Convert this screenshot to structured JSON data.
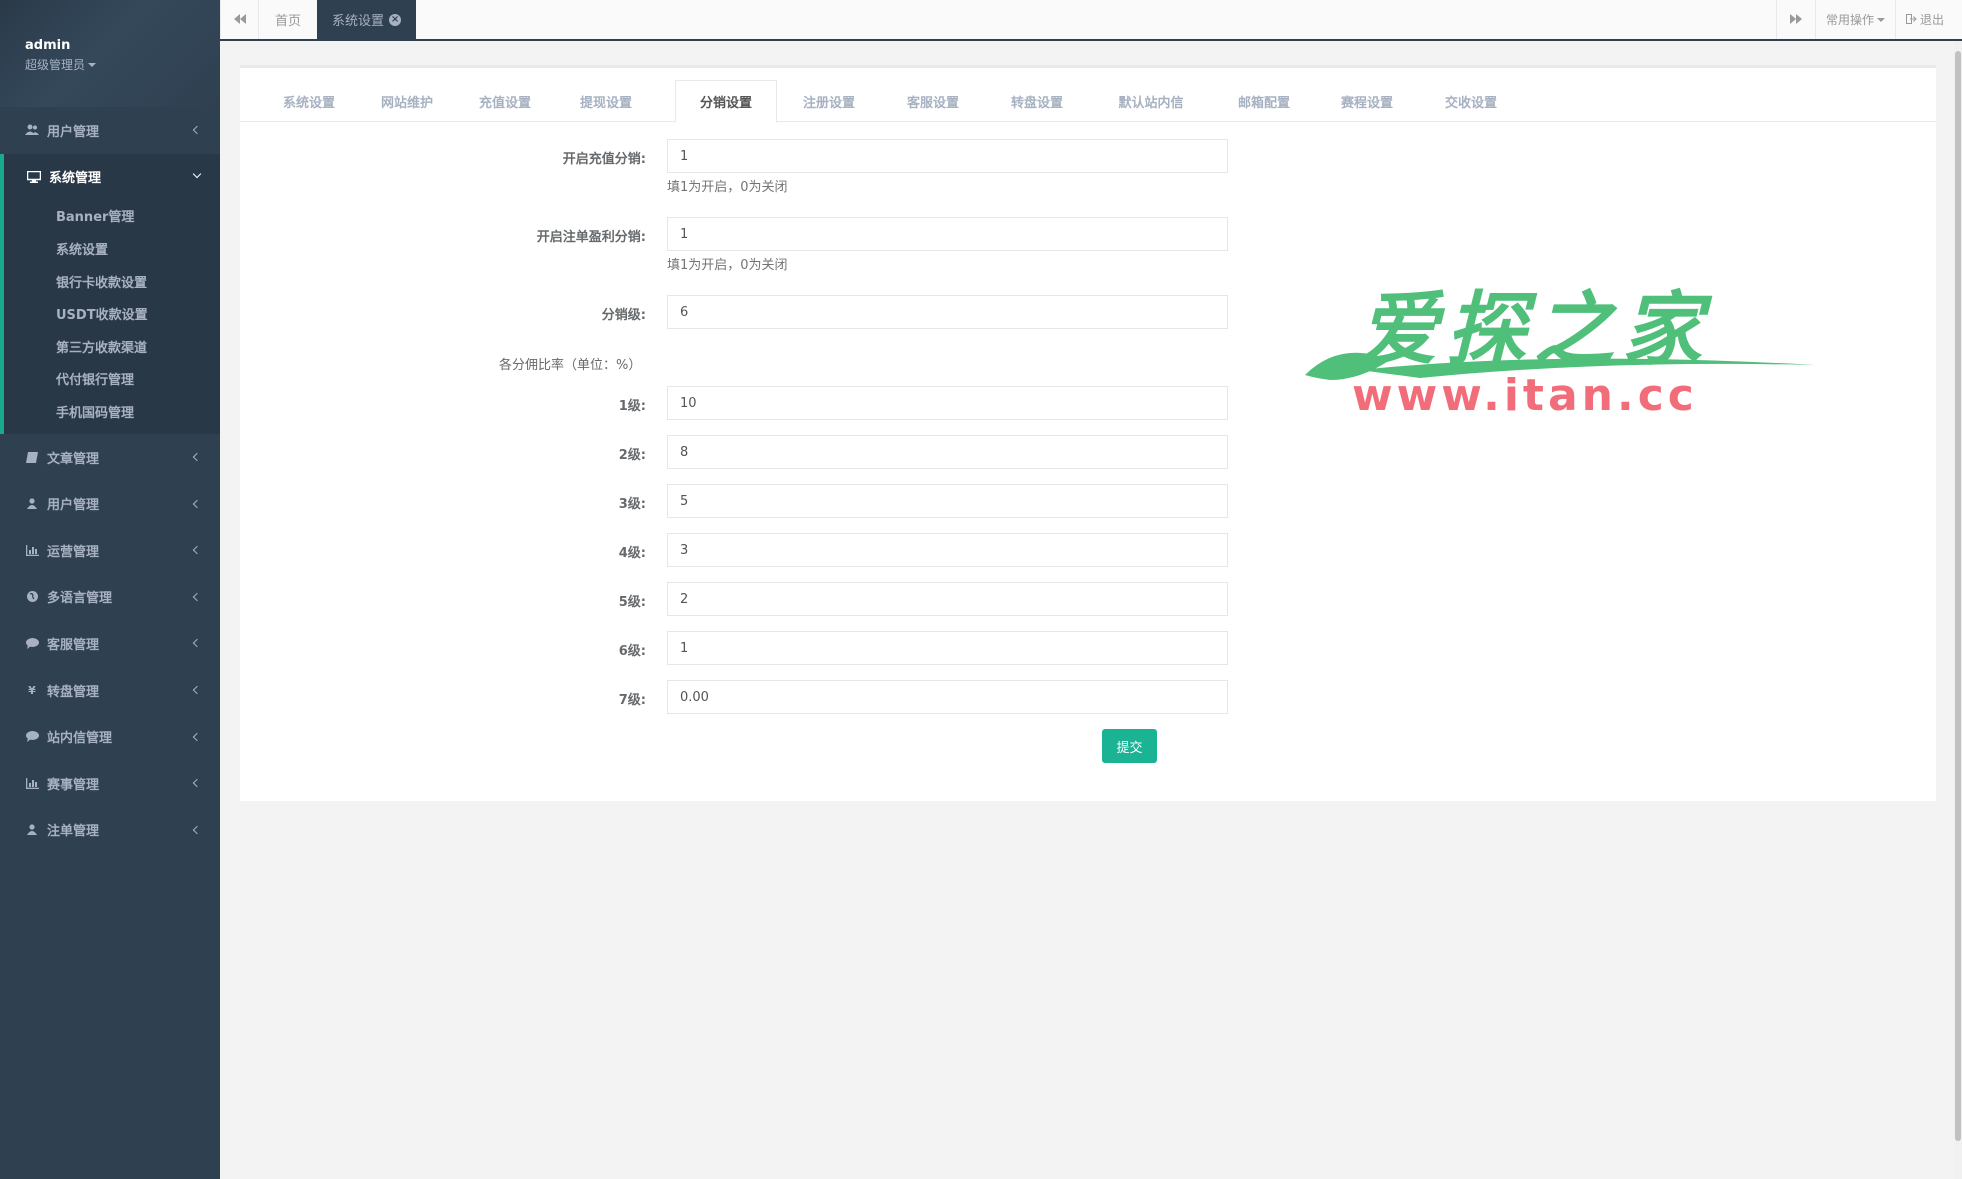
{
  "sidebar": {
    "user_name": "admin",
    "user_role": "超级管理员",
    "menu_top": {
      "label": "用户管理",
      "icon": "users-icon"
    },
    "active_menu": {
      "label": "系统管理",
      "icon": "monitor-icon",
      "children": [
        "Banner管理",
        "系统设置",
        "银行卡收款设置",
        "USDT收款设置",
        "第三方收款渠道",
        "代付银行管理",
        "手机国码管理"
      ]
    },
    "menu_bottom": [
      {
        "label": "文章管理",
        "icon": "book-icon"
      },
      {
        "label": "用户管理",
        "icon": "user-icon"
      },
      {
        "label": "运营管理",
        "icon": "bar-chart-icon"
      },
      {
        "label": "多语言管理",
        "icon": "globe-icon"
      },
      {
        "label": "客服管理",
        "icon": "comment-icon"
      },
      {
        "label": "转盘管理",
        "icon": "yen-icon"
      },
      {
        "label": "站内信管理",
        "icon": "comment-icon"
      },
      {
        "label": "赛事管理",
        "icon": "bar-chart-icon"
      },
      {
        "label": "注单管理",
        "icon": "user-icon"
      }
    ]
  },
  "topbar": {
    "tabs": [
      {
        "label": "首页"
      },
      {
        "label": "系统设置"
      }
    ],
    "ops_label": "常用操作",
    "logout_label": "退出"
  },
  "settings_tabs": [
    "系统设置",
    "网站维护",
    "充值设置",
    "提现设置",
    "分销设置",
    "注册设置",
    "客服设置",
    "转盘设置",
    "默认站内信",
    "邮箱配置",
    "赛程设置",
    "交收设置"
  ],
  "form": {
    "recharge_dist": {
      "label": "开启充值分销:",
      "value": "1",
      "help": "填1为开启，0为关闭"
    },
    "bet_profit_dist": {
      "label": "开启注单盈利分销:",
      "value": "1",
      "help": "填1为开启，0为关闭"
    },
    "dist_level": {
      "label": "分销级:",
      "value": "6"
    },
    "rate_section": "各分佣比率（单位：%）",
    "levels": [
      {
        "label": "1级:",
        "value": "10"
      },
      {
        "label": "2级:",
        "value": "8"
      },
      {
        "label": "3级:",
        "value": "5"
      },
      {
        "label": "4级:",
        "value": "3"
      },
      {
        "label": "5级:",
        "value": "2"
      },
      {
        "label": "6级:",
        "value": "1"
      },
      {
        "label": "7级:",
        "value": "0.00"
      }
    ],
    "submit_label": "提交"
  },
  "watermark": {
    "title": "爱探之家",
    "url": "www.itan.cc"
  }
}
